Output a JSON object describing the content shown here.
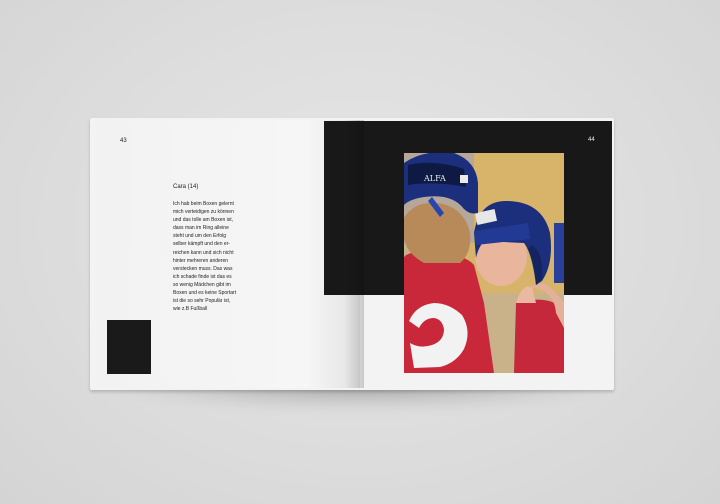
{
  "book": {
    "left_page_number": "43",
    "right_page_number": "44",
    "heading": "Cara (14)",
    "body": "Ich hab beim Boxen gelernt\nmich verteidigen  zu können\nund das tolle am Boxen ist,\ndass man im Ring alleine\nsteht und um den Erfolg\nselber kämpft und den er-\nreichen kann und sich nicht\nhinter mehreren anderen\nverstecken muss. Das was\nich schade finde ist das es\nso wenig Mädchen gibt im\nBoxen und es keine Sportart\nist die so sehr Populär  ist,\nwie z.B Fußball"
  },
  "photo": {
    "headgear_label": "ALFA",
    "colors": {
      "headgear_blue": "#1b2f7c",
      "jersey_red": "#c8283a",
      "wall_yellow": "#caa25a"
    }
  }
}
